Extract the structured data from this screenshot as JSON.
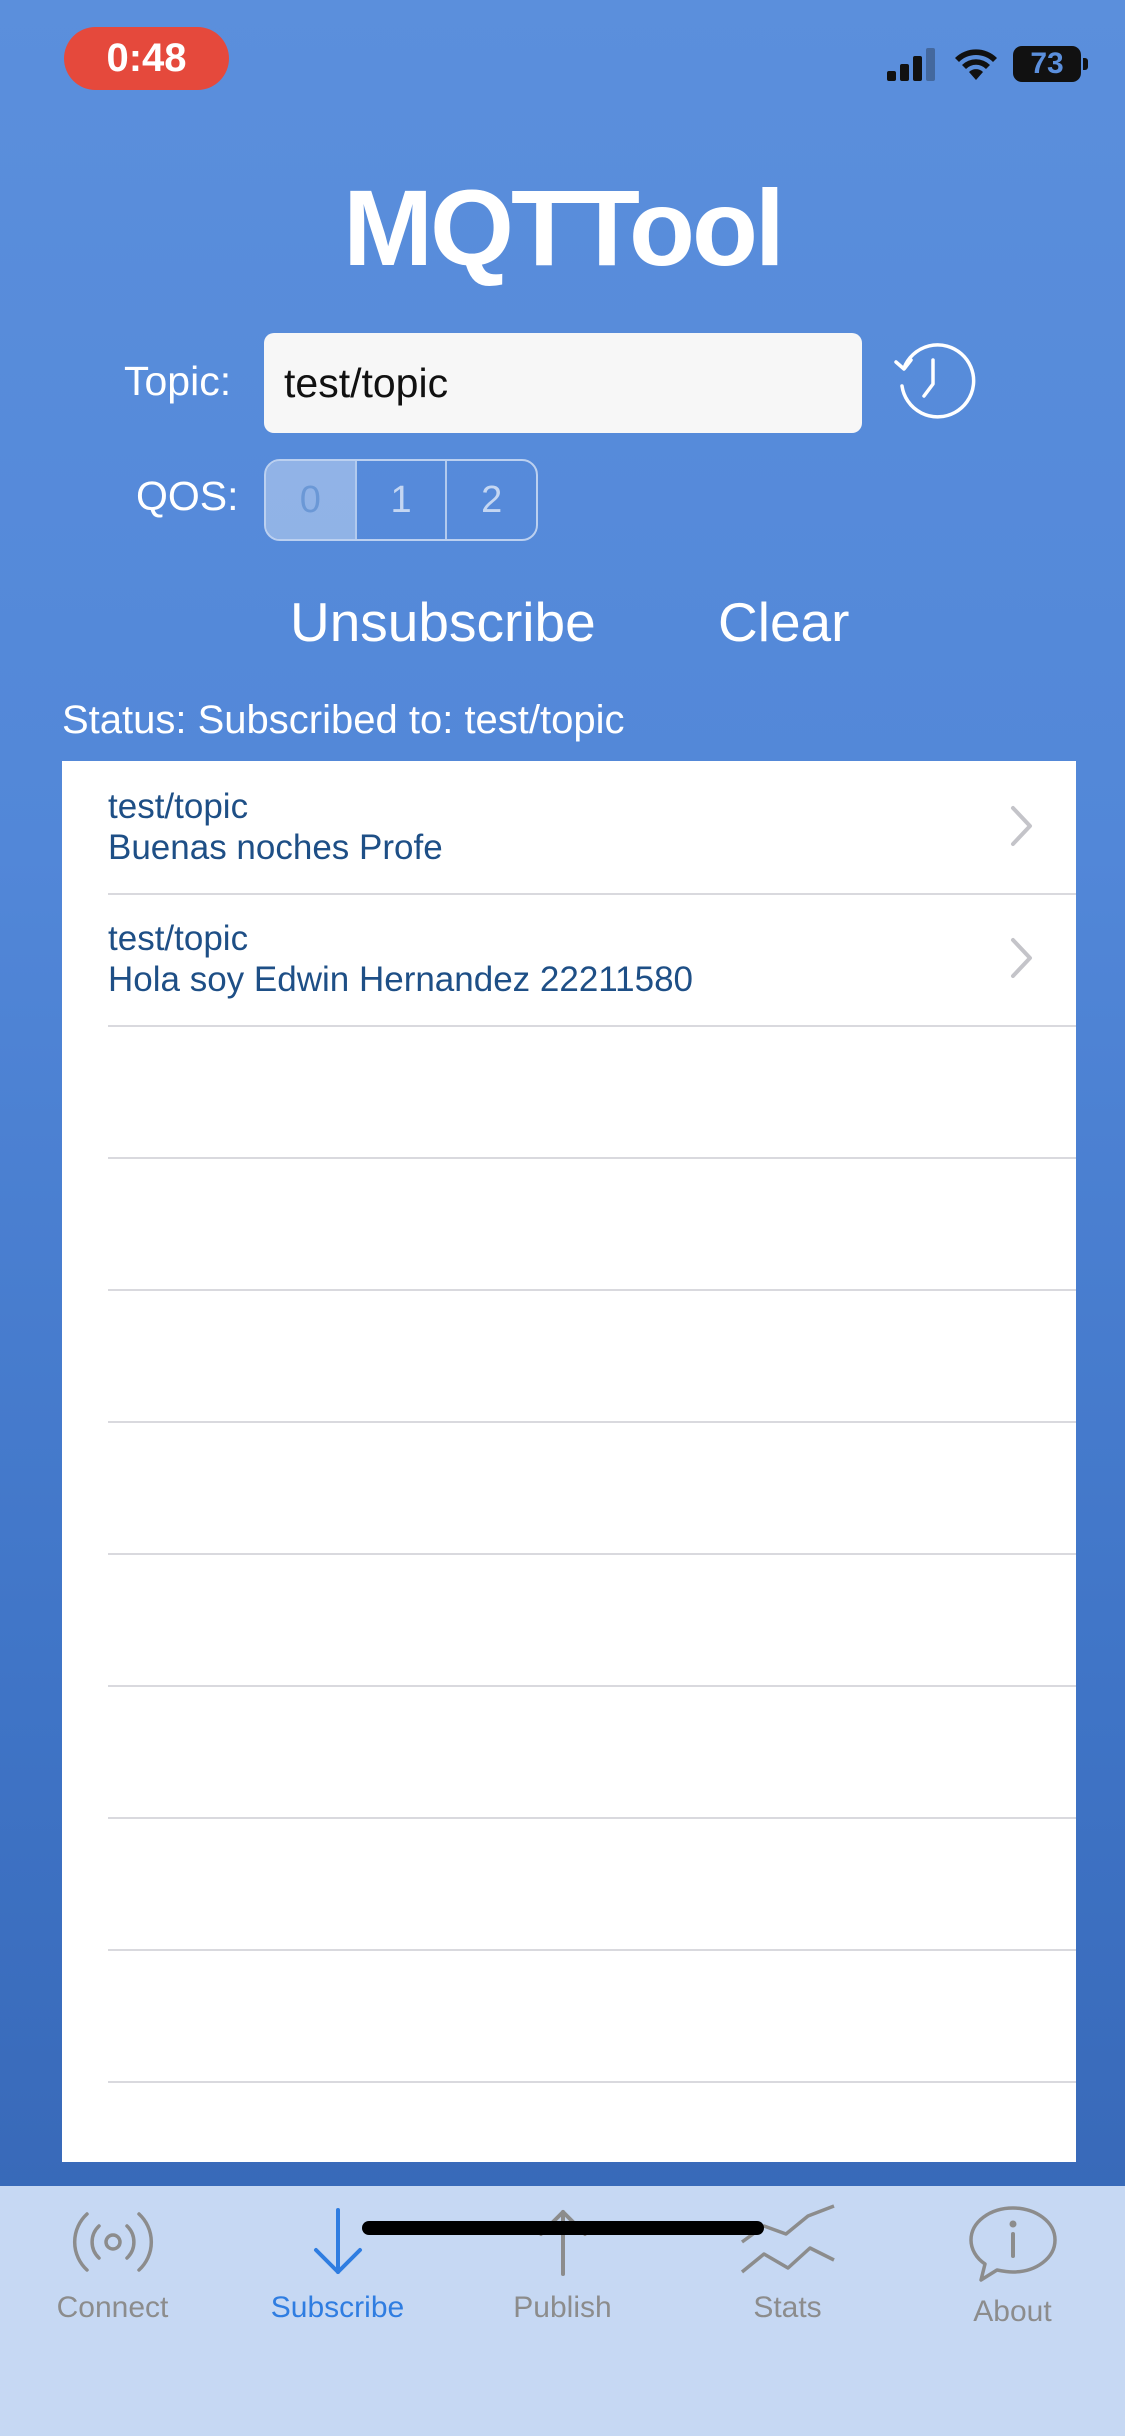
{
  "status_bar": {
    "time": "0:48",
    "battery": "73"
  },
  "app": {
    "title": "MQTTool"
  },
  "topic": {
    "label": "Topic:",
    "value": "test/topic"
  },
  "qos": {
    "label": "QOS:",
    "options": [
      "0",
      "1",
      "2"
    ],
    "selected": "0"
  },
  "actions": {
    "unsubscribe": "Unsubscribe",
    "clear": "Clear"
  },
  "status": {
    "text": "Status: Subscribed to: test/topic"
  },
  "messages": [
    {
      "topic": "test/topic",
      "payload": "Buenas noches Profe"
    },
    {
      "topic": "test/topic",
      "payload": "Hola soy Edwin Hernandez 22211580"
    }
  ],
  "tabs": [
    {
      "label": "Connect",
      "icon": "broadcast-icon"
    },
    {
      "label": "Subscribe",
      "icon": "arrow-down-icon",
      "active": true
    },
    {
      "label": "Publish",
      "icon": "arrow-up-icon"
    },
    {
      "label": "Stats",
      "icon": "stats-chart-icon"
    },
    {
      "label": "About",
      "icon": "info-bubble-icon"
    }
  ],
  "colors": {
    "accent": "#2f7de1",
    "background": "#5287d8",
    "record_pill": "#e5493c",
    "message_text": "#1e4f86"
  }
}
